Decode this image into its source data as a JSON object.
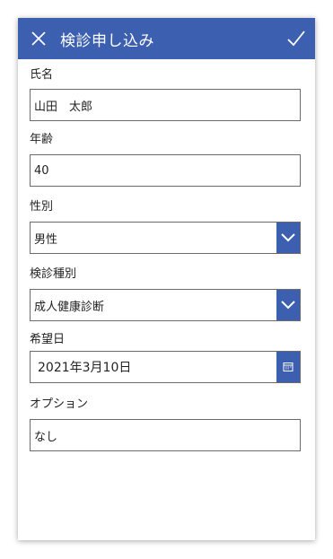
{
  "header": {
    "title": "検診申し込み",
    "close_icon": "close-icon",
    "confirm_icon": "checkmark-icon",
    "bg_color": "#3d5fb0"
  },
  "fields": {
    "name": {
      "label": "氏名",
      "value": "山田　太郎"
    },
    "age": {
      "label": "年齢",
      "value": "40"
    },
    "gender": {
      "label": "性別",
      "value": "男性"
    },
    "exam_type": {
      "label": "検診種別",
      "value": "成人健康診断"
    },
    "desired_date": {
      "label": "希望日",
      "value": "2021年3月10日"
    },
    "options": {
      "label": "オプション",
      "value": "なし"
    }
  },
  "colors": {
    "accent": "#3d5fb0",
    "border": "#6b6b6b",
    "text": "#222222"
  }
}
